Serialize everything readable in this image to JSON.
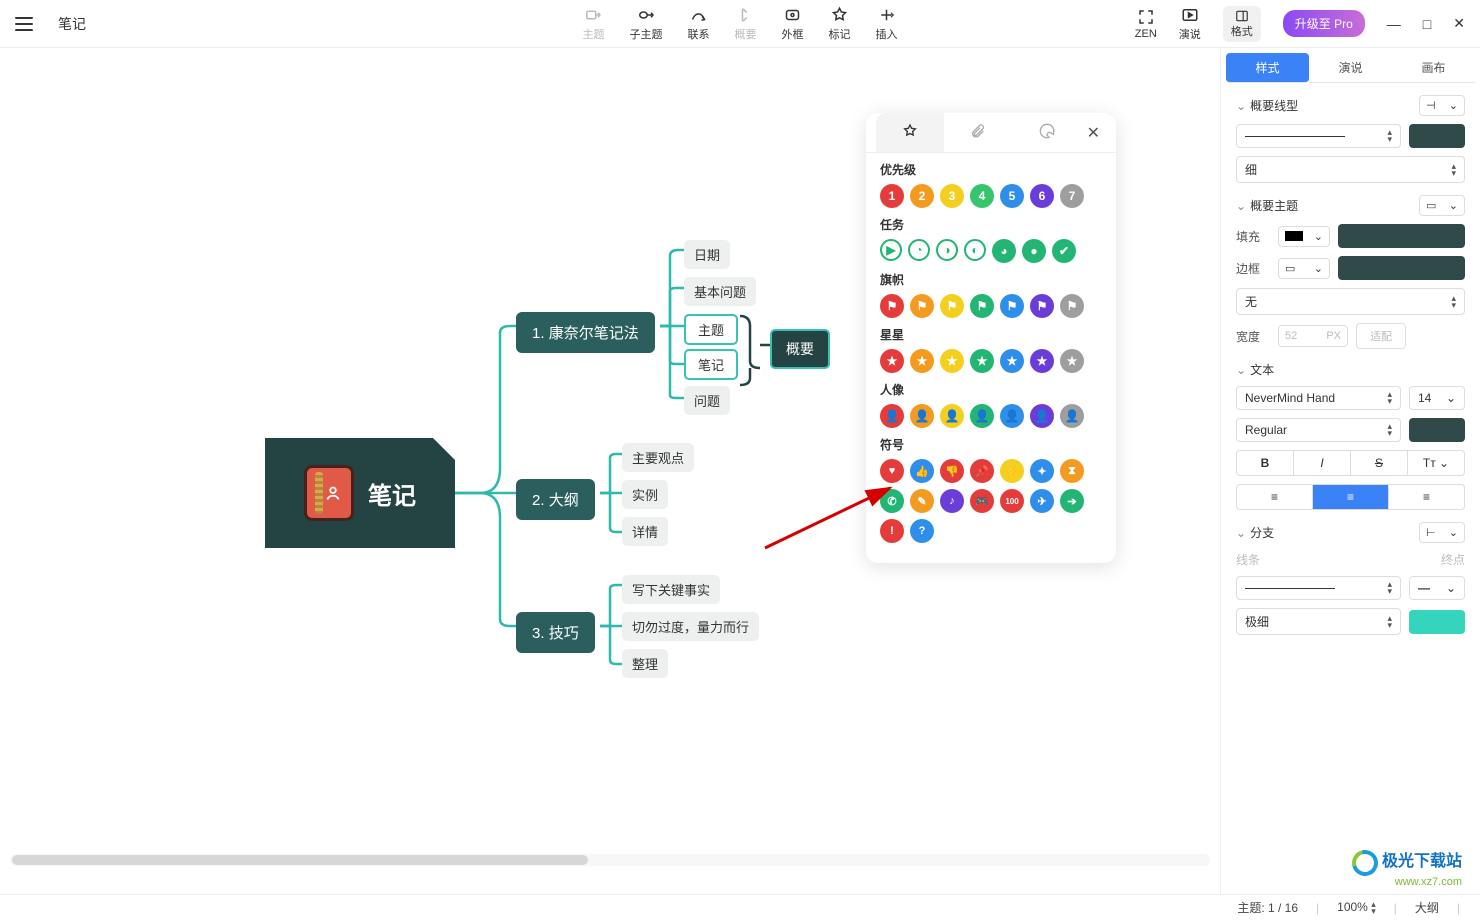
{
  "app": {
    "title": "笔记"
  },
  "toolbar": {
    "items": [
      {
        "id": "topic",
        "label": "主题"
      },
      {
        "id": "subtopic",
        "label": "子主题"
      },
      {
        "id": "relation",
        "label": "联系"
      },
      {
        "id": "summary",
        "label": "概要"
      },
      {
        "id": "frame",
        "label": "外框"
      },
      {
        "id": "marker",
        "label": "标记"
      },
      {
        "id": "insert",
        "label": "插入"
      }
    ],
    "right": {
      "zen": "ZEN",
      "present": "演说",
      "format": "格式",
      "upgrade": "升级至 Pro"
    }
  },
  "window_controls": {
    "minimize": "—",
    "maximize": "□",
    "close": "✕"
  },
  "mindmap": {
    "root": "笔记",
    "branches": [
      {
        "num": "1.",
        "label": "康奈尔笔记法",
        "children": [
          "日期",
          "基本问题",
          "主题",
          "笔记",
          "问题"
        ],
        "boxed": [
          2,
          3
        ],
        "summary": "概要"
      },
      {
        "num": "2.",
        "label": "大纲",
        "children": [
          "主要观点",
          "实例",
          "详情"
        ]
      },
      {
        "num": "3.",
        "label": "技巧",
        "children": [
          "写下关键事实",
          "切勿过度，量力而行",
          "整理"
        ]
      }
    ]
  },
  "marker_popup": {
    "tabs": [
      "star",
      "clip",
      "sticker"
    ],
    "groups": [
      {
        "title": "优先级",
        "type": "number",
        "colors": [
          "#e43b3b",
          "#f39b1f",
          "#f3cf1f",
          "#36c46d",
          "#2f8eea",
          "#6a3dd9",
          "#9e9e9e"
        ]
      },
      {
        "title": "任务",
        "type": "task",
        "colors": [
          "#22b573",
          "#22b573",
          "#22b573",
          "#22b573",
          "#22b573",
          "#22b573",
          "#22b573"
        ]
      },
      {
        "title": "旗帜",
        "type": "flag",
        "colors": [
          "#e43b3b",
          "#f39b1f",
          "#f3cf1f",
          "#22b573",
          "#2f8eea",
          "#6a3dd9",
          "#9e9e9e"
        ]
      },
      {
        "title": "星星",
        "type": "star",
        "colors": [
          "#e43b3b",
          "#f39b1f",
          "#f3cf1f",
          "#22b573",
          "#2f8eea",
          "#6a3dd9",
          "#9e9e9e"
        ]
      },
      {
        "title": "人像",
        "type": "person",
        "colors": [
          "#e43b3b",
          "#f39b1f",
          "#f3cf1f",
          "#22b573",
          "#2f8eea",
          "#6a3dd9",
          "#9e9e9e"
        ]
      },
      {
        "title": "符号",
        "type": "symbol",
        "row1": [
          {
            "c": "#e43b3b",
            "g": "♥"
          },
          {
            "c": "#2f8eea",
            "g": "👍"
          },
          {
            "c": "#e43b3b",
            "g": "👎"
          },
          {
            "c": "#e43b3b",
            "g": "📌"
          },
          {
            "c": "#f3cf1f",
            "g": "⚡"
          },
          {
            "c": "#2f8eea",
            "g": "✦"
          },
          {
            "c": "#f39b1f",
            "g": "⧗"
          }
        ],
        "row2": [
          {
            "c": "#22b573",
            "g": "✆"
          },
          {
            "c": "#f39b1f",
            "g": "✎"
          },
          {
            "c": "#6a3dd9",
            "g": "♪"
          },
          {
            "c": "#e43b3b",
            "g": "🎮"
          },
          {
            "c": "#e43b3b",
            "g": "100"
          },
          {
            "c": "#2f8eea",
            "g": "✈"
          },
          {
            "c": "#22b573",
            "g": "➔"
          }
        ],
        "row3": [
          {
            "c": "#e43b3b",
            "g": "!"
          },
          {
            "c": "#2f8eea",
            "g": "?"
          }
        ]
      }
    ]
  },
  "sidepanel": {
    "tabs": [
      "样式",
      "演说",
      "画布"
    ],
    "sec_summary_line": "概要线型",
    "thickness": "细",
    "sec_summary_topic": "概要主题",
    "fill": "填充",
    "border": "边框",
    "border_style": "无",
    "width": "宽度",
    "width_value": "52",
    "width_unit": "PX",
    "fit": "适配",
    "sec_text": "文本",
    "font": "NeverMind Hand",
    "font_size": "14",
    "font_weight": "Regular",
    "sec_branch": "分支",
    "line_label": "线条",
    "endpoint_label": "终点",
    "branch_thin": "极细"
  },
  "statusbar": {
    "topics": "主题: 1 / 16",
    "zoom": "100%",
    "view": "大纲"
  },
  "watermark": {
    "t1": "极光下载站",
    "t2": "www.xz7.com"
  }
}
